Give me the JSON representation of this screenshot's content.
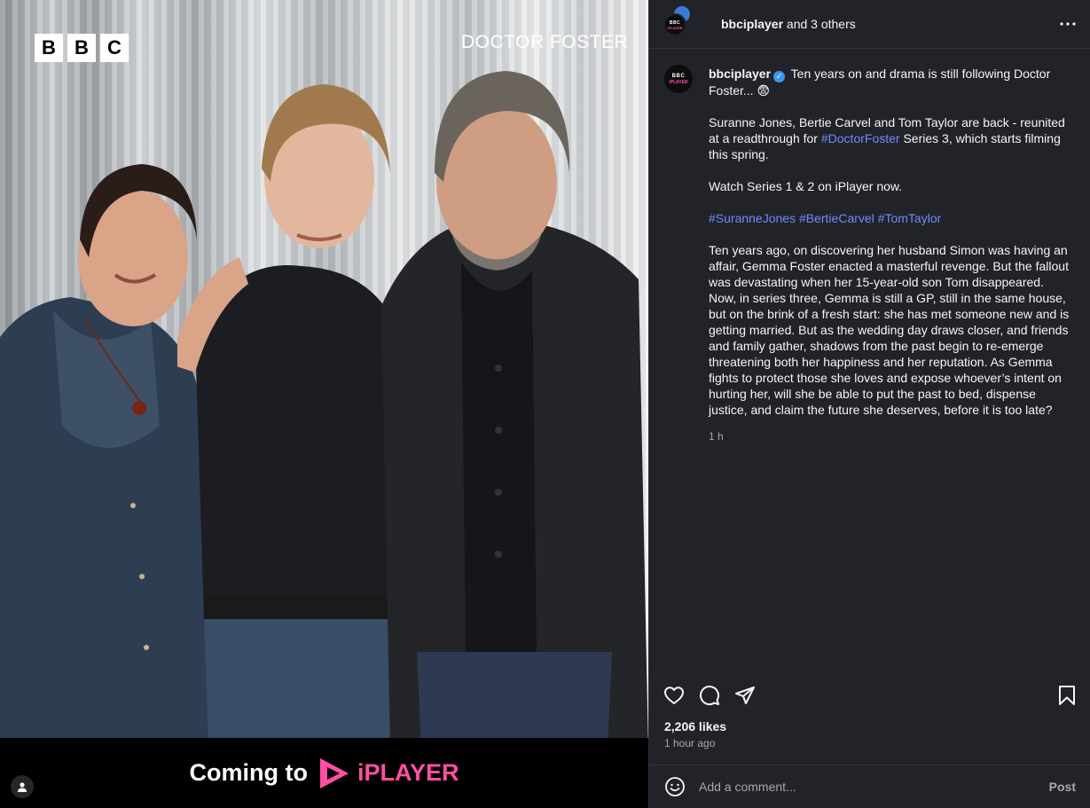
{
  "media": {
    "brand_logo_letters": [
      "B",
      "B",
      "C"
    ],
    "show_title": "DOCTOR FOSTER",
    "banner_text": "Coming to",
    "iplayer_label": "iPLAYER"
  },
  "header": {
    "username": "bbciplayer",
    "others": " and 3 others",
    "more_icon": "more-horizontal-icon"
  },
  "avatar": {
    "line1": "BBC",
    "line2": "iPLAYER"
  },
  "caption": {
    "username": "bbciplayer",
    "intro": "Ten years on and drama is still following Doctor Foster... 😨",
    "para2_before": "Suranne Jones, Bertie Carvel and Tom Taylor are back - reunited at a readthrough for ",
    "para2_tag": "#DoctorFoster",
    "para2_after": " Series 3, which starts filming this spring.",
    "para3": "Watch Series 1 & 2 on iPlayer now.",
    "hashtags": [
      "#SuranneJones",
      "#BertieCarvel",
      "#TomTaylor"
    ],
    "para5": "Ten years ago, on discovering her husband Simon was having an affair, Gemma Foster enacted a masterful revenge. But the fallout was devastating when her 15-year-old son Tom disappeared. Now, in series three, Gemma is still a GP, still in the same house, but on the brink of a fresh start: she has met someone new and is getting married. But as the wedding day draws closer, and friends and family gather, shadows from the past begin to re-emerge threatening both her happiness and her reputation. As Gemma fights to protect those she loves and expose whoever’s intent on hurting her, will she be able to put the past to bed, dispense justice, and claim the future she deserves, before it is too late?",
    "time": "1 h"
  },
  "engagement": {
    "likes": "2,206 likes",
    "time_ago": "1 hour ago"
  },
  "comment": {
    "placeholder": "Add a comment...",
    "post_label": "Post"
  },
  "colors": {
    "panel_bg": "#212328",
    "hashtag": "#6e8cff",
    "iplayer_pink": "#ff4fa3",
    "verified_blue": "#3897f0"
  }
}
